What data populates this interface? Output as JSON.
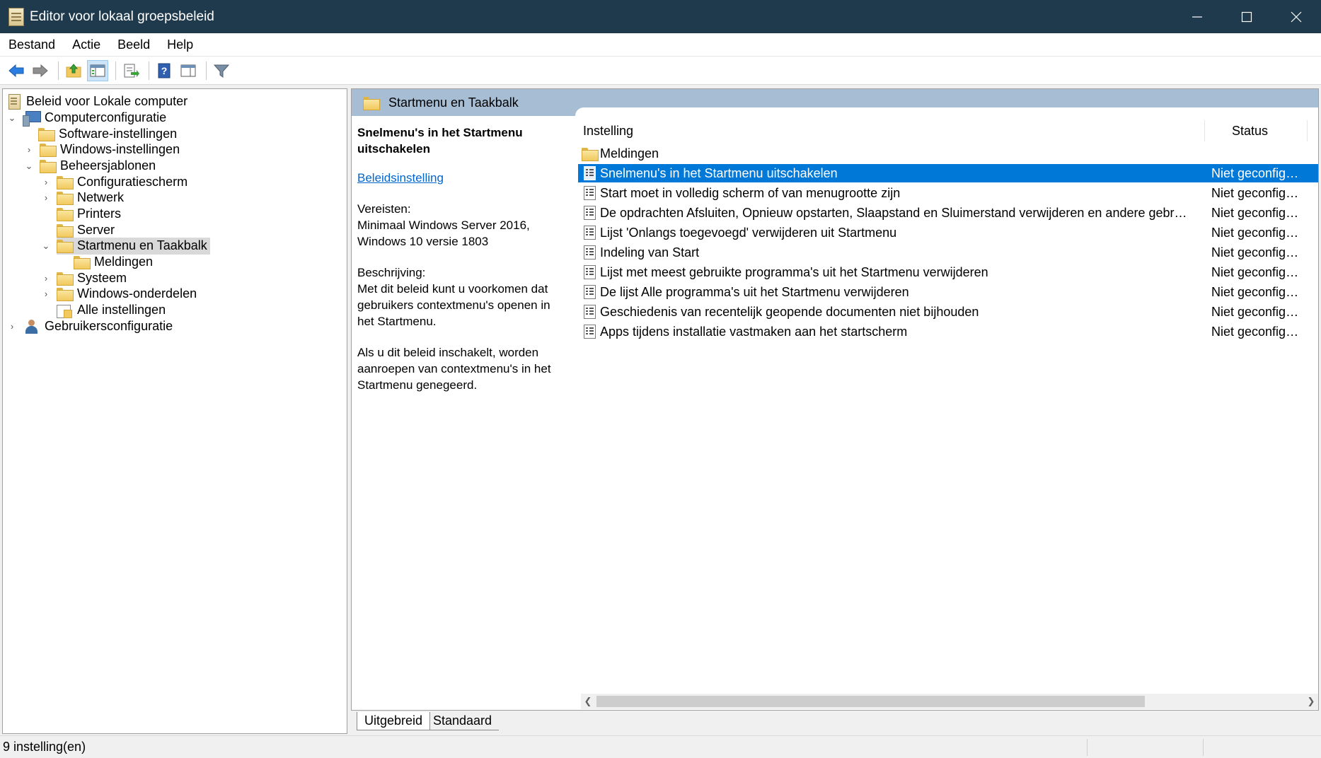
{
  "window": {
    "title": "Editor voor lokaal groepsbeleid"
  },
  "menu": [
    "Bestand",
    "Actie",
    "Beeld",
    "Help"
  ],
  "tree": {
    "root": "Beleid voor Lokale computer",
    "items": [
      {
        "label": "Computerconfiguratie",
        "expanded": true
      },
      {
        "label": "Software-instellingen"
      },
      {
        "label": "Windows-instellingen",
        "expanded": false
      },
      {
        "label": "Beheersjablonen",
        "expanded": true
      },
      {
        "label": "Configuratiescherm",
        "expanded": false
      },
      {
        "label": "Netwerk",
        "expanded": false
      },
      {
        "label": "Printers"
      },
      {
        "label": "Server"
      },
      {
        "label": "Startmenu en Taakbalk",
        "expanded": true,
        "selected": true
      },
      {
        "label": "Meldingen"
      },
      {
        "label": "Systeem",
        "expanded": false
      },
      {
        "label": "Windows-onderdelen",
        "expanded": false
      },
      {
        "label": "Alle instellingen"
      },
      {
        "label": "Gebruikersconfiguratie",
        "expanded": false
      }
    ]
  },
  "right": {
    "header": "Startmenu en Taakbalk",
    "description": {
      "title": "Snelmenu's in het Startmenu uitschakelen",
      "link": "Beleidsinstelling",
      "req_label": "Vereisten:",
      "req_text": "Minimaal Windows Server 2016, Windows 10 versie 1803",
      "desc_label": "Beschrijving:",
      "desc_text": "Met dit beleid kunt u voorkomen dat gebruikers contextmenu's openen in het Startmenu.",
      "desc_text2": "Als u dit beleid inschakelt, worden aanroepen van contextmenu's in het Startmenu genegeerd."
    },
    "columns": {
      "setting": "Instelling",
      "status": "Status"
    },
    "folder_row": "Meldingen",
    "rows": [
      {
        "name": "Snelmenu's in het Startmenu uitschakelen",
        "status": "Niet geconfigu...",
        "selected": true
      },
      {
        "name": "Start moet in volledig scherm of van menugrootte zijn",
        "status": "Niet geconfigu..."
      },
      {
        "name": "De opdrachten Afsluiten, Opnieuw opstarten, Slaapstand en Sluimerstand verwijderen en andere gebruiks...",
        "status": "Niet geconfigu..."
      },
      {
        "name": "Lijst 'Onlangs toegevoegd' verwijderen uit Startmenu",
        "status": "Niet geconfigu..."
      },
      {
        "name": "Indeling van Start",
        "status": "Niet geconfigu..."
      },
      {
        "name": "Lijst met meest gebruikte programma's uit het Startmenu verwijderen",
        "status": "Niet geconfigu..."
      },
      {
        "name": "De lijst Alle programma's uit het Startmenu verwijderen",
        "status": "Niet geconfigu..."
      },
      {
        "name": "Geschiedenis van recentelijk geopende documenten niet bijhouden",
        "status": "Niet geconfigu..."
      },
      {
        "name": "Apps tijdens installatie vastmaken aan het startscherm",
        "status": "Niet geconfigu..."
      }
    ]
  },
  "tabs": [
    "Uitgebreid",
    "Standaard"
  ],
  "statusbar": {
    "text": "9 instelling(en)"
  }
}
